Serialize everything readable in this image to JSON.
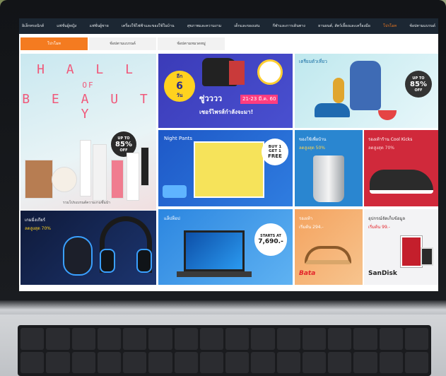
{
  "nav": {
    "items": [
      "อิเล็กทรอนิกส์",
      "แฟชั่นผู้หญิง",
      "แฟชั่นผู้ชาย",
      "เครื่องใช้ไฟฟ้าและของใช้ในบ้าน",
      "สุขภาพและความงาม",
      "เด็กและของเล่น",
      "กีฬาและการเดินทาง",
      "ยานยนต์, สัตว์เลี้ยงและเครื่องมือ",
      "โปรโมท",
      "ช้อปตามแบรนด์"
    ]
  },
  "tabs": [
    "โปรโมท",
    "ช้อปตามแบรนด์",
    "ช้อปตามหมวดหมู่"
  ],
  "tiles": {
    "beauty": {
      "line1": "H A L L",
      "line2": "OF",
      "line3": "B E A U T Y",
      "badge_top": "UP TO",
      "badge_pct": "85%",
      "badge_off": "OFF",
      "caption": "รวมโปรแบรนด์ความงามชั้นนำ"
    },
    "shoes": {
      "days_label": "อีก",
      "days": "6",
      "days_unit": "วัน",
      "headline": "ซู่วววว",
      "dates": "21-23 มี.ค. 60",
      "sub": "เซอร์ไพรส์กำลังจะมา!"
    },
    "backpack": {
      "title": "เตรียมตัวเที่ยว",
      "badge_top": "UP TO",
      "badge_pct": "85%",
      "badge_off": "OFF"
    },
    "nightpants": {
      "title": "Night Pants",
      "badge1": "BUY 1",
      "badge2": "GET 1",
      "badge3": "FREE"
    },
    "kitchen": {
      "title": "ของใช้เพื่อบ้าน",
      "sub": "ลดสูงสุด 50%"
    },
    "kicks": {
      "title": "รองเท้าร้าน Cool Kicks",
      "sub": "ลดสูงสุด 70%"
    },
    "gaming": {
      "title": "เกมมิ่งเกียร์",
      "sub": "ลดสูงสุด 70%"
    },
    "laptop": {
      "title": "แล็ปท็อป",
      "badge1": "STARTS AT",
      "badge2": "7,690.-"
    },
    "bata": {
      "title": "รองเท้า",
      "sub": "เริ่มต้น 294.-",
      "brand": "Bata"
    },
    "sandisk": {
      "title": "อุปกรณ์จัดเก็บข้อมูล",
      "sub": "เริ่มต้น 99.-",
      "brand": "SanDisk"
    }
  }
}
